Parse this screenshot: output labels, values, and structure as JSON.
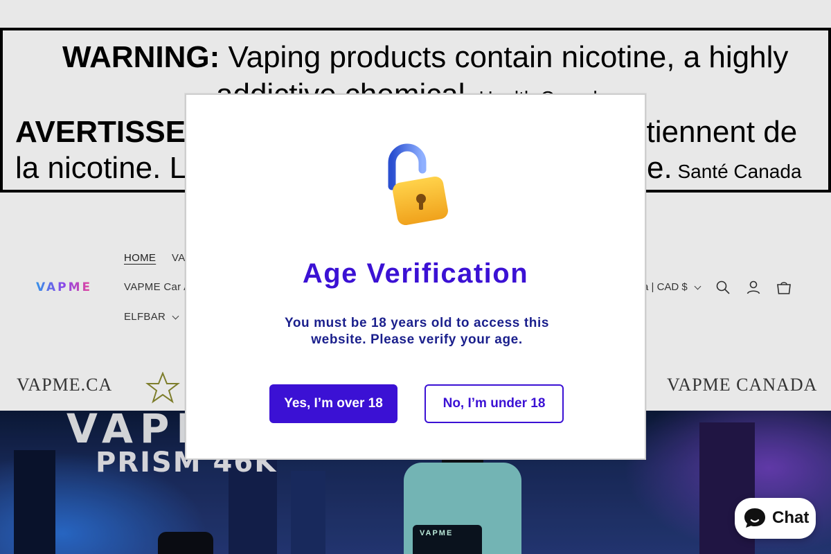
{
  "warning": {
    "line1_bold": "WARNING:",
    "line1_rest": " Vaping products contain nicotine, a highly",
    "line2": "addictive chemical.",
    "line2_source": " Health Canada",
    "line3_left": "AVERTISSE",
    "line3_right": "ntiennent de",
    "line4_left": "la nicotine. La",
    "line4_right": "e.",
    "line4_source": " Santé Canada"
  },
  "header": {
    "logo_text": "VAPME",
    "nav": {
      "home": "HOME",
      "va_partial": "VA",
      "car_partial": "VAPME Car A",
      "elfbar": "ELFBAR"
    },
    "currency": "a | CAD $",
    "icons": [
      "search-icon",
      "account-icon",
      "cart-icon"
    ]
  },
  "strip": {
    "left": "VAPME.CA",
    "right": "VAPME CANADA"
  },
  "hero": {
    "brand": "VAPM",
    "model": "PRISM 46K",
    "device_label": "VAPME"
  },
  "modal": {
    "title": "Age Verification",
    "message": "You must be 18 years old to access this website. Please verify your age.",
    "yes_label": "Yes, I’m over 18",
    "no_label": "No, I’m under 18",
    "icon": "unlocked-padlock-icon"
  },
  "chat": {
    "label": "Chat",
    "icon": "chat-bubble-icon"
  },
  "colors": {
    "accent": "#3b11d4",
    "modal_text": "#1a1f8c"
  }
}
